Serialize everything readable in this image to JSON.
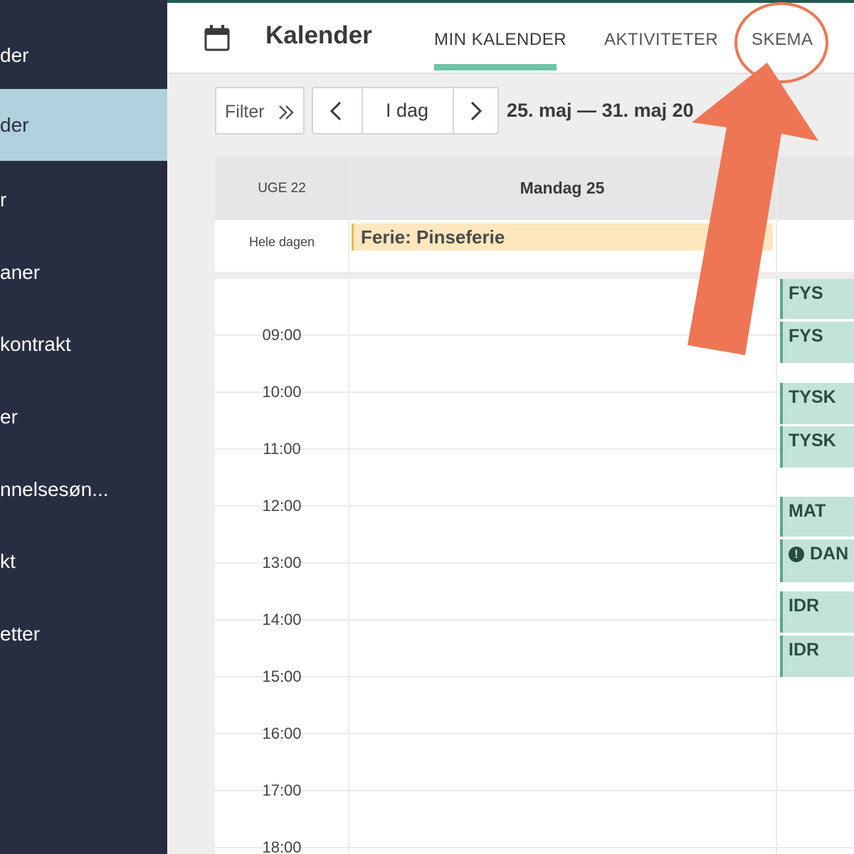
{
  "sidebar": {
    "items": [
      {
        "label": "der"
      },
      {
        "label": "der"
      },
      {
        "label": "r"
      },
      {
        "label": "aner"
      },
      {
        "label": "kontrakt"
      },
      {
        "label": "er"
      },
      {
        "label": "nnelsesøn..."
      },
      {
        "label": "kt"
      },
      {
        "label": "etter"
      }
    ],
    "active_index": 1
  },
  "header": {
    "title": "Kalender",
    "tabs": [
      {
        "label": "MIN KALENDER",
        "active": true
      },
      {
        "label": "AKTIVITETER"
      },
      {
        "label": "SKEMA"
      }
    ]
  },
  "toolbar": {
    "filter_label": "Filter",
    "today_label": "I dag",
    "date_range": "25. maj — 31. maj 20"
  },
  "calendar": {
    "week_label": "UGE 22",
    "day_label": "Mandag 25",
    "allday_label": "Hele dagen",
    "allday_event": "Ferie: Pinseferie",
    "times": [
      "09:00",
      "10:00",
      "11:00",
      "12:00",
      "13:00",
      "14:00",
      "15:00",
      "16:00",
      "17:00",
      "18:00"
    ],
    "events": [
      {
        "label": "FYS"
      },
      {
        "label": "FYS"
      },
      {
        "label": "TYSK"
      },
      {
        "label": "TYSK"
      },
      {
        "label": "MAT"
      },
      {
        "label": "DAN",
        "warning_icon": true
      },
      {
        "label": "IDR"
      },
      {
        "label": "IDR"
      }
    ]
  },
  "colors": {
    "sidebar_bg": "#282e42",
    "sidebar_active": "#b1d1de",
    "tab_accent": "#6fc3a7",
    "event_bg": "#c3e3d6",
    "allday_event_bg": "#fde7bf",
    "annotation": "#ef7654"
  }
}
